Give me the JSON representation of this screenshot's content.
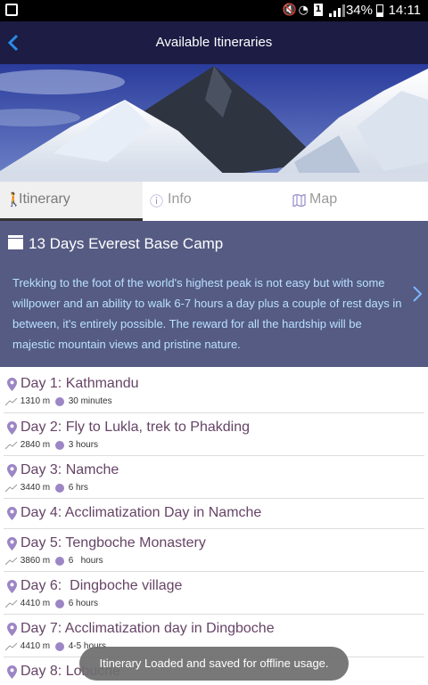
{
  "status_bar": {
    "battery": "34%",
    "time": "14:11",
    "sim_slot": "1"
  },
  "header": {
    "title": "Available Itineraries"
  },
  "tabs": [
    {
      "label": "Itinerary",
      "icon": "hiker-icon",
      "active": true
    },
    {
      "label": "Info",
      "icon": "info-icon",
      "active": false
    },
    {
      "label": "Map",
      "icon": "map-icon",
      "active": false
    }
  ],
  "summary": {
    "title": "13 Days Everest Base Camp",
    "description": "Trekking to the foot of the world's highest peak is not easy but with some willpower and an ability to walk 6-7 hours a day plus a couple of rest days in between, it's entirely possible. The reward for all the hardship will be majestic mountain views and pristine nature."
  },
  "days": [
    {
      "title": "Day 1: Kathmandu",
      "altitude": "1310 m",
      "duration": "30 minutes"
    },
    {
      "title": "Day 2: Fly to Lukla, trek to Phakding",
      "altitude": "2840 m",
      "duration": "3 hours"
    },
    {
      "title": "Day 3: Namche",
      "altitude": "3440 m",
      "duration": "6 hrs"
    },
    {
      "title": "Day 4: Acclimatization Day in Namche",
      "altitude": "",
      "duration": ""
    },
    {
      "title": "Day 5: Tengboche Monastery",
      "altitude": "3860 m",
      "duration": "6   hours"
    },
    {
      "title": "Day 6:  Dingboche village",
      "altitude": "4410 m",
      "duration": "6 hours"
    },
    {
      "title": "Day 7: Acclimatization day in Dingboche",
      "altitude": "4410 m",
      "duration": "4-5 hours"
    },
    {
      "title": "Day 8: Lobuche",
      "altitude": "",
      "duration": ""
    }
  ],
  "toast": "Itinerary Loaded and saved for offline usage.",
  "colors": {
    "header_bg": "#1c1c44",
    "summary_bg": "#555b83",
    "summary_text": "#b9e0ff",
    "day_title": "#664466",
    "accent_purple": "#9c86c5"
  }
}
